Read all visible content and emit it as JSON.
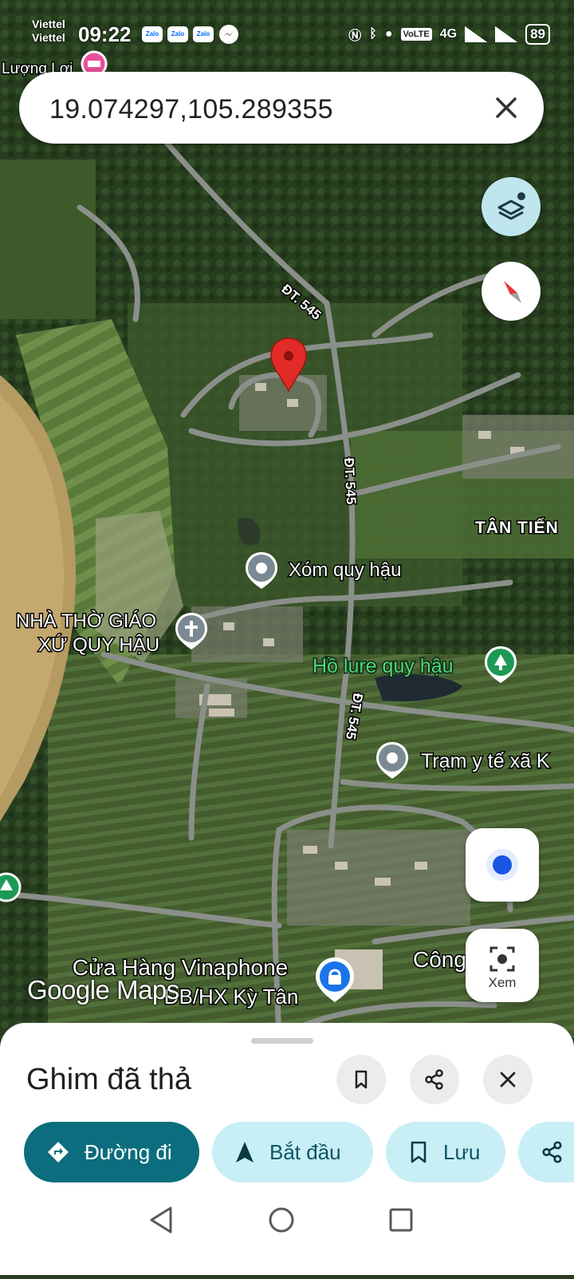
{
  "status_bar": {
    "carrier_1": "Viettel",
    "carrier_2": "Viettel",
    "time": "09:22",
    "notif_1": "Zalo",
    "notif_2": "Zalo",
    "notif_3": "Zalo",
    "network": "4G",
    "volte": "VoLTE",
    "battery": "89"
  },
  "search": {
    "query": "19.074297,105.289355"
  },
  "map": {
    "labels": {
      "top_place": "Lượng Lợi",
      "road_1": "ĐT. 545",
      "road_2": "ĐT. 545",
      "road_3": "ĐT. 545",
      "area": "TÂN TIẾN",
      "poi_1": "Xóm quy hậu",
      "poi_church_line1": "NHÀ THỜ GIÁO",
      "poi_church_line2": "XỨ QUY HẬU",
      "poi_lake": "Hồ lure quy hậu",
      "poi_clinic": "Trạm y tế xã K",
      "poi_company": "Công ty T",
      "poi_shop_line1": "Cửa Hàng Vinaphone",
      "poi_shop_line2": "ĐB/HX Kỳ Tân"
    },
    "attribution": "Google Maps",
    "lens_label": "Xem"
  },
  "sheet": {
    "title": "Ghim đã thả",
    "actions": {
      "directions": "Đường đi",
      "start": "Bắt đầu",
      "save": "Lưu"
    }
  },
  "colors": {
    "primary": "#0b6d7d",
    "secondary_chip": "#c8eff5",
    "pin": "#e12b27",
    "poi_green": "#1c9a55",
    "poi_blue": "#1a73e8"
  }
}
